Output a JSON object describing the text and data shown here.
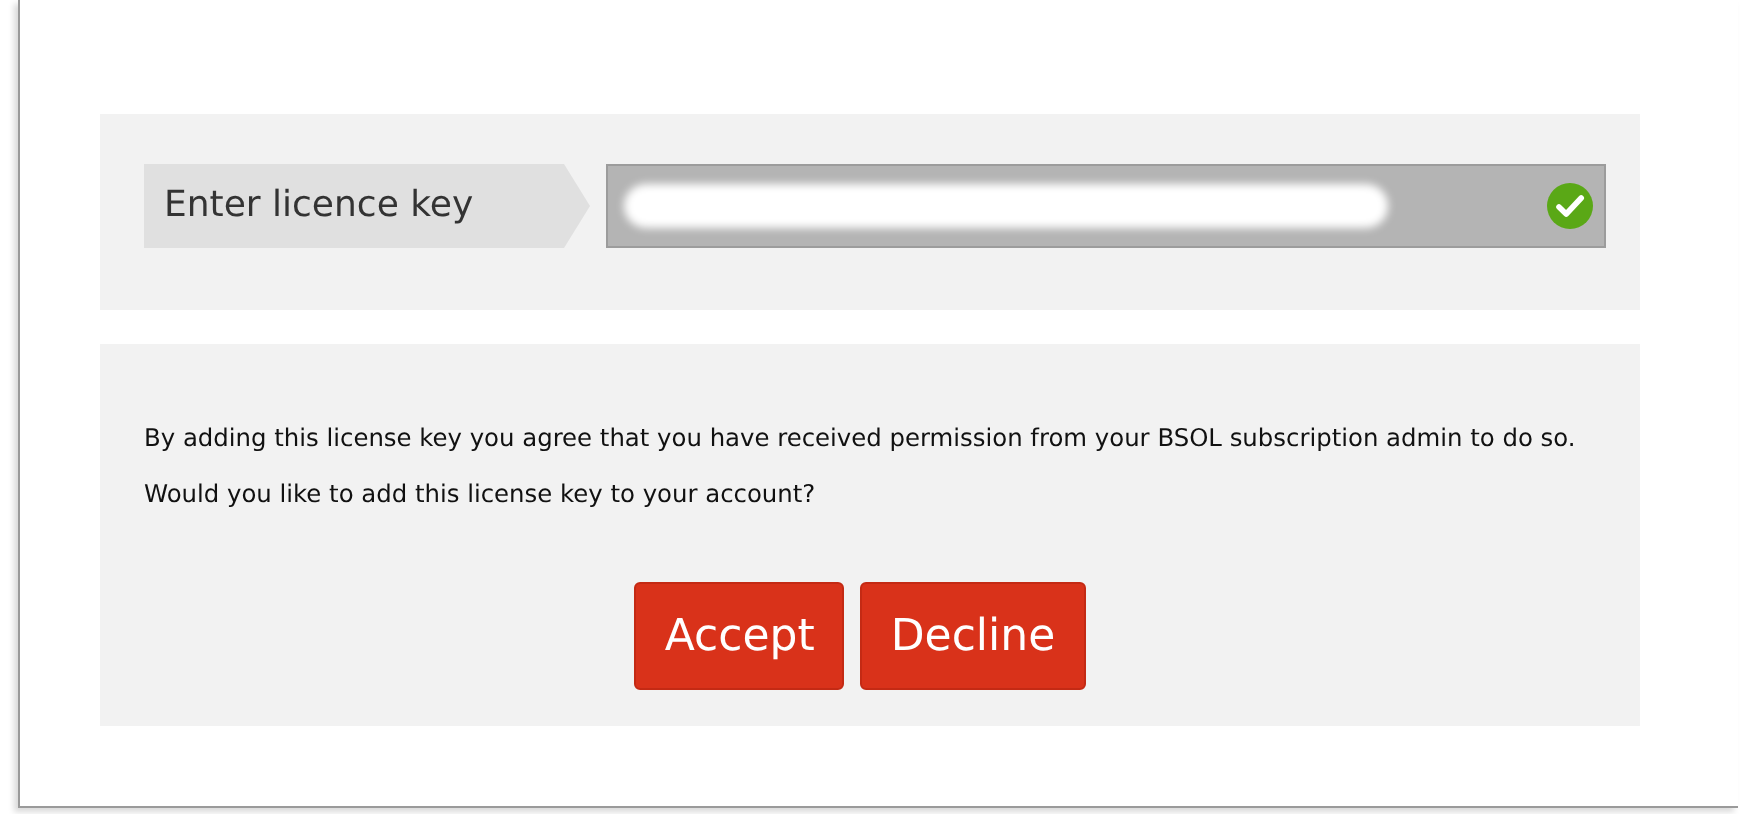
{
  "licence_key": {
    "label": "Enter licence key",
    "redacted": true,
    "valid": true
  },
  "confirmation": {
    "message": "By adding this license key you agree that you have received permission from your BSOL subscription admin to do so. Would you like to add this license key to your account?",
    "buttons": [
      "Accept",
      "Decline"
    ]
  }
}
